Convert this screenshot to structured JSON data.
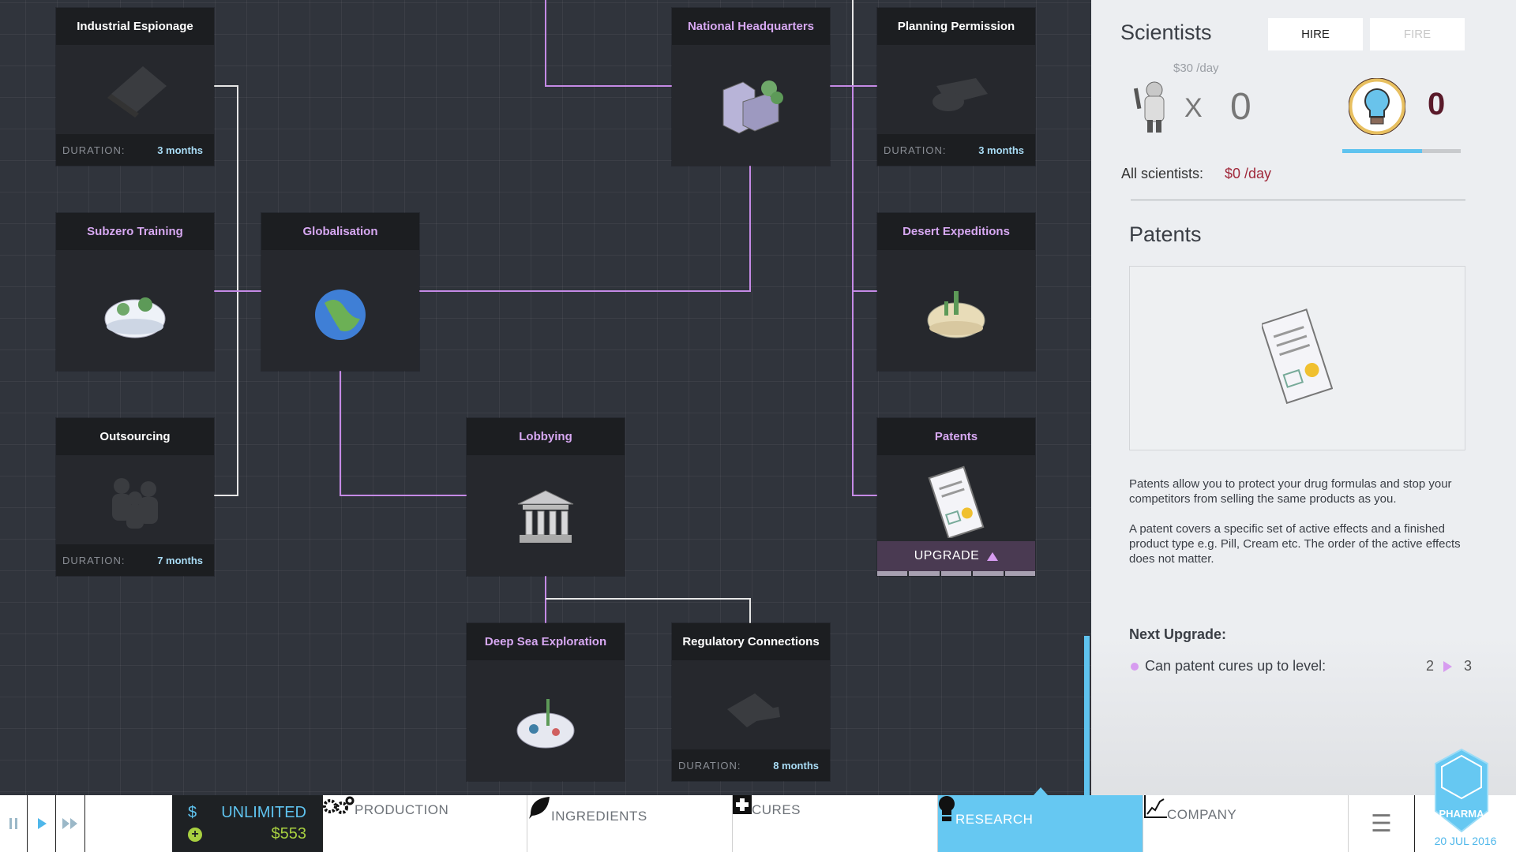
{
  "research_tree": {
    "cards": [
      {
        "id": "industrial-espionage",
        "title": "Industrial Espionage",
        "state": "locked",
        "duration_label": "DURATION:",
        "duration": "3 months",
        "icon": "laptop-icon"
      },
      {
        "id": "national-headquarters",
        "title": "National Headquarters",
        "state": "researched",
        "icon": "office-buildings-icon"
      },
      {
        "id": "planning-permission",
        "title": "Planning Permission",
        "state": "locked",
        "duration_label": "DURATION:",
        "duration": "3 months",
        "icon": "stamp-icon"
      },
      {
        "id": "subzero-training",
        "title": "Subzero Training",
        "state": "researched",
        "icon": "snow-island-icon"
      },
      {
        "id": "globalisation",
        "title": "Globalisation",
        "state": "researched",
        "icon": "globe-icon"
      },
      {
        "id": "desert-expeditions",
        "title": "Desert Expeditions",
        "state": "researched",
        "icon": "desert-island-icon"
      },
      {
        "id": "outsourcing",
        "title": "Outsourcing",
        "state": "locked",
        "duration_label": "DURATION:",
        "duration": "7 months",
        "icon": "people-icon"
      },
      {
        "id": "lobbying",
        "title": "Lobbying",
        "state": "researched",
        "icon": "government-building-icon"
      },
      {
        "id": "patents",
        "title": "Patents",
        "state": "researched",
        "icon": "certificate-icon",
        "upgrade_label": "UPGRADE",
        "upgrade_segments": 5
      },
      {
        "id": "deep-sea-exploration",
        "title": "Deep Sea Exploration",
        "state": "researched",
        "icon": "sea-island-icon"
      },
      {
        "id": "regulatory-connections",
        "title": "Regulatory Connections",
        "state": "locked",
        "duration_label": "DURATION:",
        "duration": "8 months",
        "icon": "documents-icon"
      }
    ]
  },
  "scientists": {
    "title": "Scientists",
    "hire_label": "HIRE",
    "fire_label": "FIRE",
    "cost_each": "$30 /day",
    "multiply": "X",
    "count": "0",
    "research_points": "0",
    "research_progress_percent": 67,
    "all_label": "All scientists:",
    "all_cost": "$0 /day"
  },
  "detail": {
    "title": "Patents",
    "desc1": "Patents allow you to protect your drug formulas and stop your competitors from selling the same products as you.",
    "desc2": "A patent covers a specific set of active effects and a finished product type e.g. Pill, Cream etc. The order of the active effects does not matter.",
    "next_upgrade_label": "Next Upgrade:",
    "upgrade_item": "Can patent cures up to level:",
    "from_level": "2",
    "to_level": "3"
  },
  "bottom_bar": {
    "money_symbol": "$",
    "money_limit": "UNLIMITED",
    "cash": "$553",
    "nav": [
      {
        "label": "PRODUCTION",
        "icon": "gears-icon"
      },
      {
        "label": "INGREDIENTS",
        "icon": "leaf-icon"
      },
      {
        "label": "CURES",
        "icon": "cross-icon"
      },
      {
        "label": "RESEARCH",
        "icon": "lightbulb-icon",
        "active": true
      },
      {
        "label": "COMPANY",
        "icon": "chart-icon"
      }
    ],
    "date": "20 JUL 2016"
  },
  "logo_text": "BIG PHARMA",
  "colors": {
    "accent": "#66c8f2",
    "researched_title": "#d7a8f2",
    "connector": "#c58ae6",
    "cost_red": "#a0283a"
  }
}
